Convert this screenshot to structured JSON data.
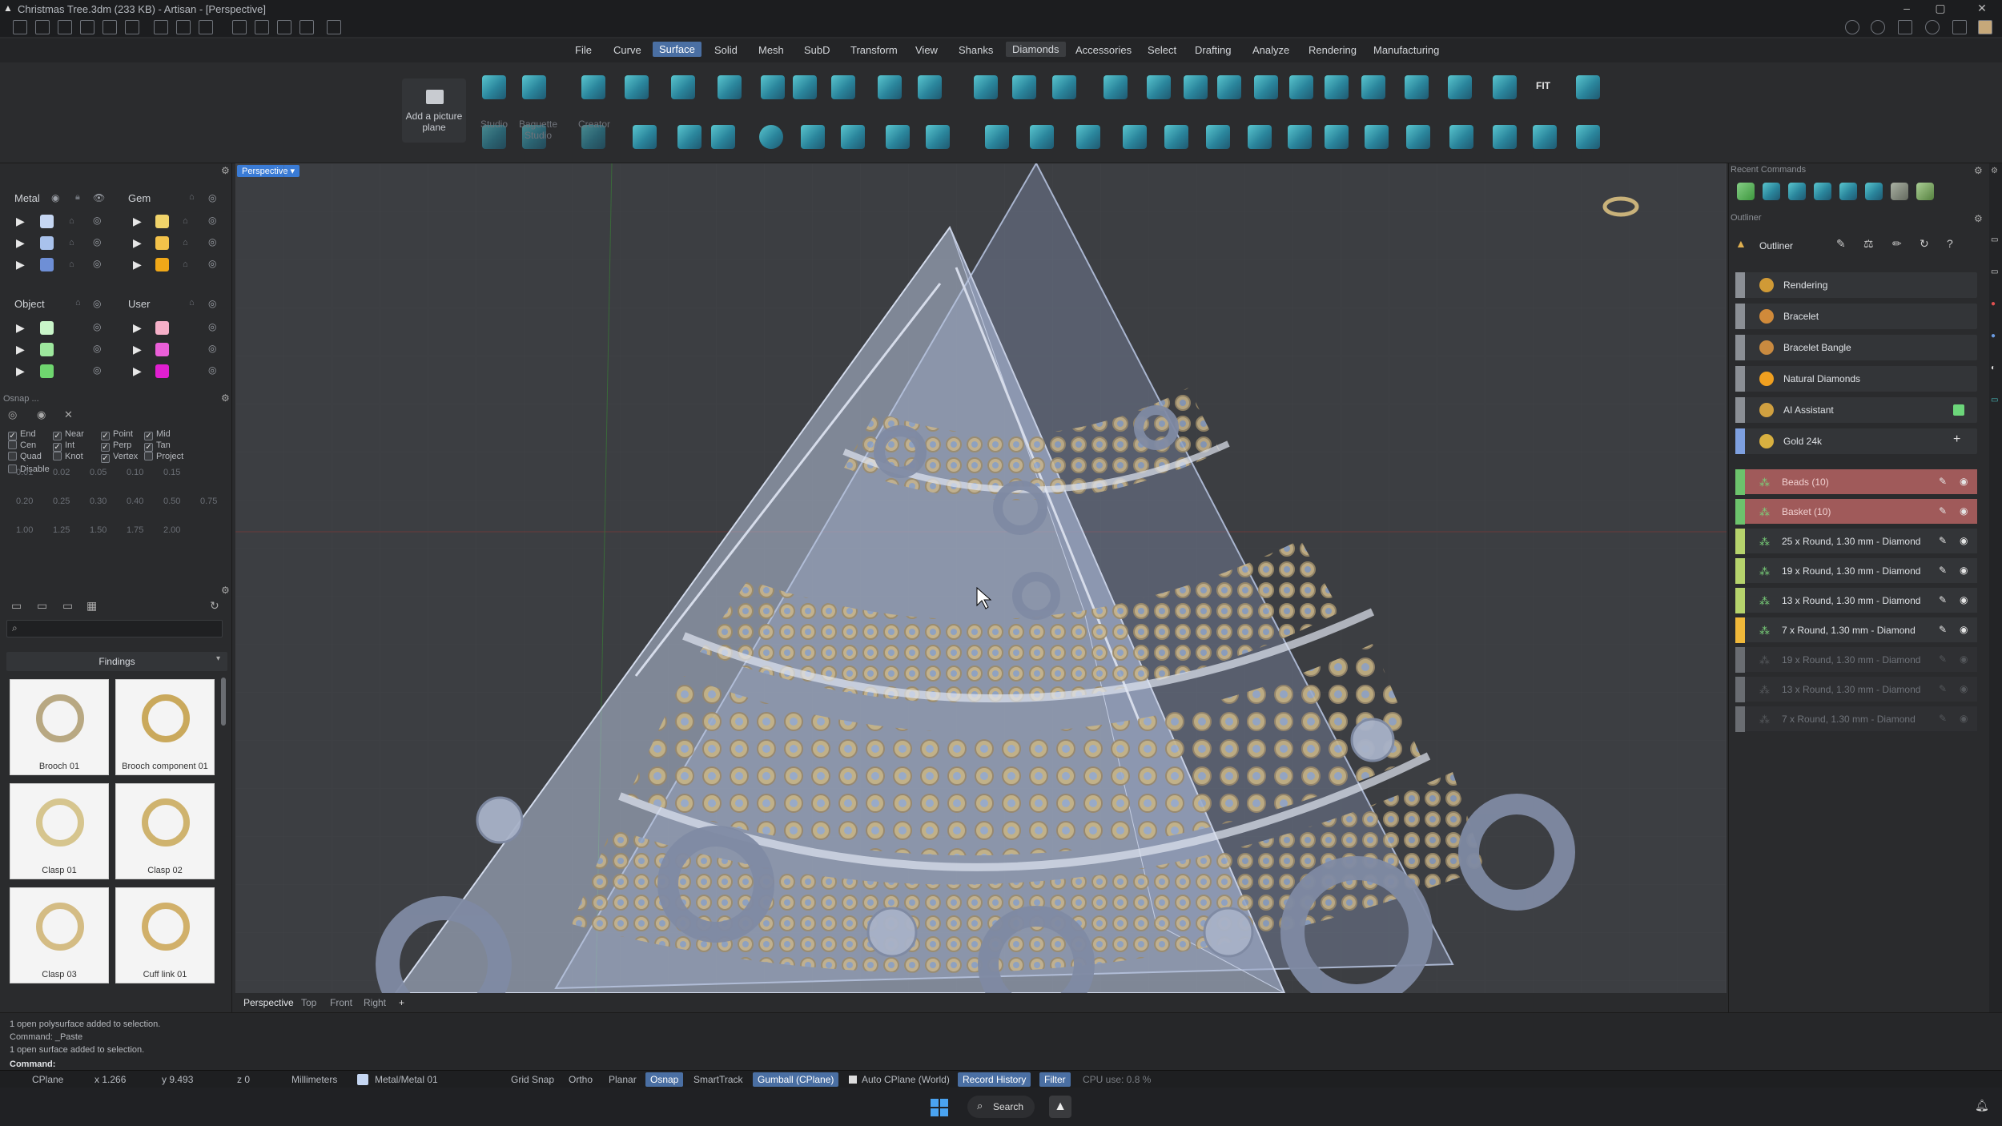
{
  "window": {
    "title": "Christmas Tree.3dm (233 KB) - Artisan - [Perspective]"
  },
  "menu": [
    {
      "label": "File"
    },
    {
      "label": "Curve"
    },
    {
      "label": "Surface",
      "active": true
    },
    {
      "label": "Solid"
    },
    {
      "label": "Mesh"
    },
    {
      "label": "SubD"
    },
    {
      "label": "Transform"
    },
    {
      "label": "View"
    },
    {
      "label": "Shanks"
    },
    {
      "label": "Diamonds",
      "hilite": true
    },
    {
      "label": "Accessories"
    },
    {
      "label": "Select"
    },
    {
      "label": "Drafting"
    },
    {
      "label": "Analyze"
    },
    {
      "label": "Rendering"
    },
    {
      "label": "Manufacturing"
    }
  ],
  "toolbar": {
    "add_picture_plane": "Add a picture plane",
    "studio": "Studio",
    "baguette_studio": "Baguette Studio",
    "creator": "Creator",
    "fit_label": "FIT"
  },
  "layers_panel": {
    "metal_header": "Metal",
    "gem_header": "Gem",
    "object_header": "Object",
    "user_header": "User",
    "metal_colors": [
      "#c5d6f2",
      "#a9c2ec",
      "#6e8fd6"
    ],
    "gem_colors": [
      "#f0d36a",
      "#f3c24a",
      "#f0a818"
    ],
    "object_colors": [
      "#c9f5c9",
      "#9ee89e",
      "#6fd66f"
    ],
    "user_colors": [
      "#f5b0c8",
      "#ea5fd8",
      "#e01fd0"
    ]
  },
  "osnap": {
    "title": "Osnap ...",
    "rows": [
      [
        {
          "label": "End",
          "checked": true
        },
        {
          "label": "Near",
          "checked": true
        },
        {
          "label": "Point",
          "checked": true
        },
        {
          "label": "Mid",
          "checked": true
        }
      ],
      [
        {
          "label": "Cen",
          "checked": false
        },
        {
          "label": "Int",
          "checked": true
        },
        {
          "label": "Perp",
          "checked": true
        },
        {
          "label": "Tan",
          "checked": true
        }
      ],
      [
        {
          "label": "Quad",
          "checked": false
        },
        {
          "label": "Knot",
          "checked": false
        },
        {
          "label": "Vertex",
          "checked": true
        },
        {
          "label": "Project",
          "checked": false
        }
      ]
    ],
    "disable": "Disable",
    "values_row1": [
      "0.01",
      "0.02",
      "0.05",
      "0.10",
      "0.15"
    ],
    "values_row2": [
      "0.20",
      "0.25",
      "0.30",
      "0.40",
      "0.50",
      "0.75"
    ],
    "values_row3": [
      "1.00",
      "1.25",
      "1.50",
      "1.75",
      "2.00"
    ]
  },
  "library": {
    "search_placeholder": "",
    "category": "Findings",
    "items": [
      {
        "label": "Brooch 01"
      },
      {
        "label": "Brooch component 01"
      },
      {
        "label": "Clasp 01"
      },
      {
        "label": "Clasp 02"
      },
      {
        "label": "Clasp 03"
      },
      {
        "label": "Cuff link 01"
      }
    ]
  },
  "viewport": {
    "active_view": "Perspective",
    "tabs": [
      "Perspective",
      "Top",
      "Front",
      "Right"
    ],
    "add_tab": "+"
  },
  "right_panel": {
    "recent_commands": "Recent Commands",
    "outliner_title": "Outliner",
    "outliner_panel_label": "Outliner",
    "items": [
      {
        "label": "Rendering"
      },
      {
        "label": "Bracelet"
      },
      {
        "label": "Bracelet Bangle"
      },
      {
        "label": "Natural Diamonds"
      },
      {
        "label": "AI Assistant"
      },
      {
        "label": "Gold 24k"
      }
    ],
    "layers": [
      {
        "label": "Beads (10)",
        "color": "#6cc36c",
        "style": "red"
      },
      {
        "label": "Basket (10)",
        "color": "#6cc36c",
        "style": "red"
      },
      {
        "label": "25 x Round, 1.30 mm - Diamond",
        "color": "#b6d36c",
        "style": "normal"
      },
      {
        "label": "19 x Round, 1.30 mm - Diamond",
        "color": "#b6d36c",
        "style": "normal"
      },
      {
        "label": "13 x Round, 1.30 mm - Diamond",
        "color": "#b6d36c",
        "style": "normal"
      },
      {
        "label": "7 x Round, 1.30 mm - Diamond",
        "color": "#f0b83a",
        "style": "normal"
      },
      {
        "label": "19 x Round, 1.30 mm - Diamond",
        "color": "#6a6d72",
        "style": "dim"
      },
      {
        "label": "13 x Round, 1.30 mm - Diamond",
        "color": "#6a6d72",
        "style": "dim"
      },
      {
        "label": "7 x Round, 1.30 mm - Diamond",
        "color": "#6a6d72",
        "style": "dim"
      }
    ]
  },
  "command": {
    "history": [
      "1 open polysurface added to selection.",
      "Command: _Paste",
      "1 open surface added to selection."
    ],
    "prompt": "Command:"
  },
  "status": {
    "cplane": "CPlane",
    "x": "x 1.266",
    "y": "y 9.493",
    "z": "z 0",
    "units": "Millimeters",
    "layer": "Metal/Metal 01",
    "grid_snap": "Grid Snap",
    "ortho": "Ortho",
    "planar": "Planar",
    "osnap": "Osnap",
    "smarttrack": "SmartTrack",
    "gumball": "Gumball (CPlane)",
    "auto_cplane": "Auto CPlane (World)",
    "record_history": "Record History",
    "filter": "Filter",
    "cpu": "CPU use: 0.8 %"
  },
  "taskbar": {
    "search": "Search"
  }
}
